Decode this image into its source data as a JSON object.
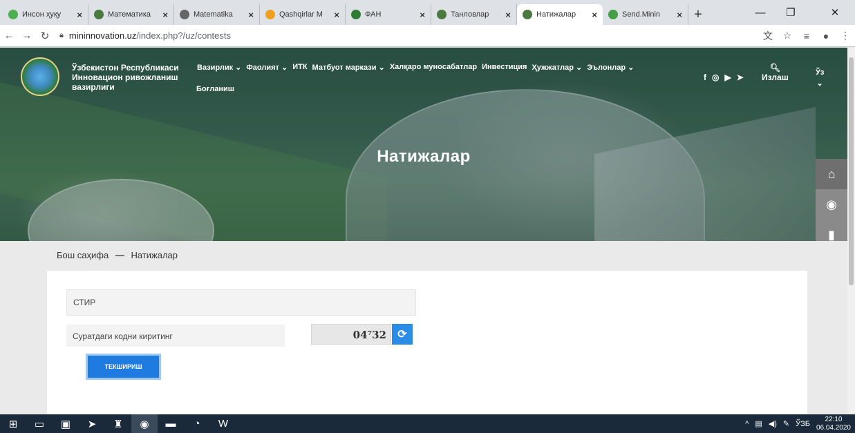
{
  "browser": {
    "tabs": [
      {
        "label": "Инсон ҳуқу",
        "color": "#4caf50",
        "icon": "people-icon"
      },
      {
        "label": "Математика",
        "color": "#4a7a40",
        "icon": "globe-icon"
      },
      {
        "label": "Matematika",
        "color": "#666666",
        "icon": "globe-icon"
      },
      {
        "label": "Qashqirlar M",
        "color": "#f0a020",
        "icon": "book-icon"
      },
      {
        "label": "ФАН",
        "color": "#2e7d32",
        "icon": "person-icon"
      },
      {
        "label": "Танловлар",
        "color": "#4a7a40",
        "icon": "globe-icon"
      },
      {
        "label": "Натижалар",
        "color": "#4a7a40",
        "icon": "globe-icon",
        "active": true
      },
      {
        "label": "Send.Minin",
        "color": "#43a047",
        "icon": "send-icon"
      }
    ],
    "new_tab": "+",
    "url_host": "mininnovation.uz",
    "url_path": "/index.php?/uz/contests"
  },
  "site": {
    "ministry_name": "Ўзбекистон Республикаси Инновацион ривожланиш вазирлиги",
    "nav": [
      "Вазирлик ⌄",
      "Фаолият ⌄",
      "ИТК",
      "Матбуот маркази ⌄",
      "Халқаро муносабатлар",
      "Инвестиция",
      "Ҳужжатлар ⌄",
      "Эълонлар ⌄"
    ],
    "nav_second": "Боғланиш",
    "social": [
      "f",
      "◎",
      "▶",
      "➤"
    ],
    "search_label": "Излаш",
    "lang": "Ўз",
    "page_title": "Натижалар"
  },
  "breadcrumb": {
    "home": "Бош саҳифа",
    "separator": "—",
    "current": "Натижалар"
  },
  "form": {
    "field_value": "СТИР",
    "captcha_label": "Суратдаги кодни киритинг",
    "captcha_code": "04⁷32",
    "submit_label": "ТЕКШИРИШ"
  },
  "taskbar": {
    "tray_lang": "ЎЗБ",
    "time": "22:10",
    "date": "06.04.2020"
  }
}
